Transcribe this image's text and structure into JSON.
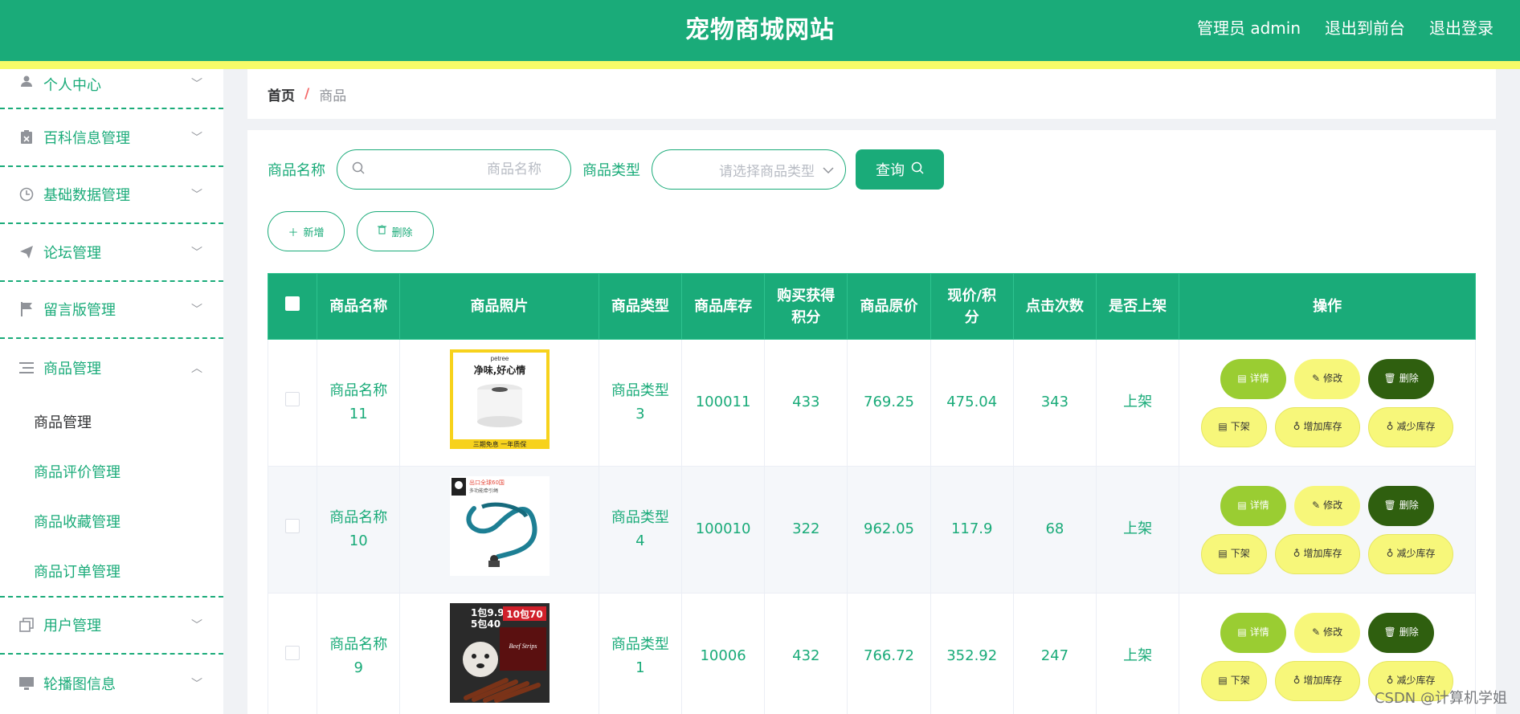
{
  "header": {
    "title": "宠物商城网站",
    "links": [
      "管理员 admin",
      "退出到前台",
      "退出登录"
    ]
  },
  "sidebar": {
    "groups_top": [
      {
        "label": "个人中心",
        "icon": "user-icon"
      },
      {
        "label": "百科信息管理",
        "icon": "clipboard-icon"
      },
      {
        "label": "基础数据管理",
        "icon": "clock-icon"
      },
      {
        "label": "论坛管理",
        "icon": "send-icon"
      },
      {
        "label": "留言版管理",
        "icon": "flag-icon"
      },
      {
        "label": "商品管理",
        "icon": "list-icon"
      }
    ],
    "sub_items": [
      "商品管理",
      "商品评价管理",
      "商品收藏管理",
      "商品订单管理"
    ],
    "groups_bottom": [
      {
        "label": "用户管理",
        "icon": "copy-icon"
      },
      {
        "label": "轮播图信息",
        "icon": "monitor-icon"
      }
    ]
  },
  "breadcrumb": {
    "home": "首页",
    "separator": "/",
    "current": "商品"
  },
  "search": {
    "name_label": "商品名称",
    "name_placeholder": "商品名称",
    "type_label": "商品类型",
    "type_placeholder": "请选择商品类型",
    "query_label": "查询"
  },
  "actions": {
    "add_label": "新增",
    "delete_label": "删除"
  },
  "table": {
    "headers": [
      "商品名称",
      "商品照片",
      "商品类型",
      "商品库存",
      "购买获得积分",
      "商品原价",
      "现价/积分",
      "点击次数",
      "是否上架",
      "操作"
    ],
    "header_lines": {
      "points": [
        "购买获得",
        "积分"
      ],
      "price": [
        "现价/积",
        "分"
      ]
    },
    "op_labels": {
      "detail": "详情",
      "edit": "修改",
      "delete": "删除",
      "off": "下架",
      "add_stock": "增加库存",
      "reduce_stock": "减少库存"
    },
    "rows": [
      {
        "name_l1": "商品名称",
        "name_l2": "11",
        "type_l1": "商品类型",
        "type_l2": "3",
        "stock": "100011",
        "points": "433",
        "orig_price": "769.25",
        "price": "475.04",
        "clicks": "343",
        "status": "上架",
        "photo": {
          "brand": "petree",
          "slogan": "净味,好心情",
          "footer": "三期免息   一年质保"
        }
      },
      {
        "name_l1": "商品名称",
        "name_l2": "10",
        "type_l1": "商品类型",
        "type_l2": "4",
        "stock": "100010",
        "points": "322",
        "orig_price": "962.05",
        "price": "117.9",
        "clicks": "68",
        "status": "上架",
        "photo": {
          "tag1": "出口全球60国",
          "tag2": "多功能牵引绳"
        }
      },
      {
        "name_l1": "商品名称",
        "name_l2": "9",
        "type_l1": "商品类型",
        "type_l2": "1",
        "stock": "10006",
        "points": "432",
        "orig_price": "766.72",
        "price": "352.92",
        "clicks": "247",
        "status": "上架",
        "photo": {
          "line1": "1包9.9",
          "line2": "5包40",
          "badge": "10包70",
          "brand": "Beef Strips"
        }
      }
    ]
  },
  "watermark": "CSDN @计算机学姐",
  "colors": {
    "primary": "#1aab79",
    "stripe": "#f6fb68",
    "detail": "#9acd32",
    "delete": "#2f5f0f",
    "yellow": "#f7f77a"
  }
}
